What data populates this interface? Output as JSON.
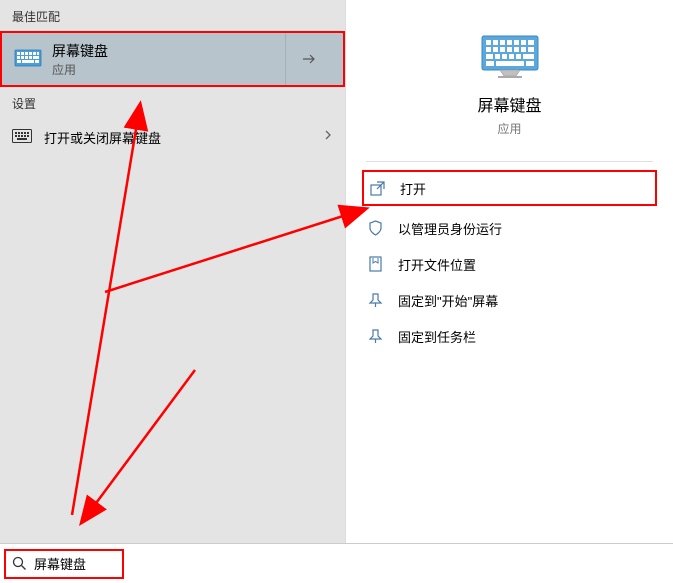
{
  "left": {
    "best_match_header": "最佳匹配",
    "best_match": {
      "title": "屏幕键盘",
      "subtitle": "应用"
    },
    "settings_header": "设置",
    "settings_item": "打开或关闭屏幕键盘"
  },
  "right": {
    "app_title": "屏幕键盘",
    "app_subtitle": "应用",
    "actions": {
      "open": "打开",
      "run_admin": "以管理员身份运行",
      "open_location": "打开文件位置",
      "pin_start": "固定到\"开始\"屏幕",
      "pin_taskbar": "固定到任务栏"
    }
  },
  "search": {
    "value": "屏幕键盘"
  },
  "colors": {
    "annotation": "#ff0000",
    "selected_bg": "#b8c4cc",
    "left_bg": "#e4e4e4"
  }
}
